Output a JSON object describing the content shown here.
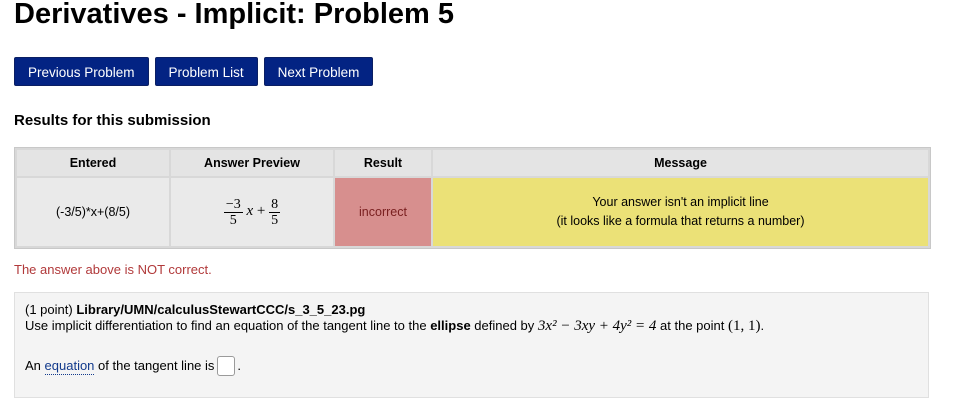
{
  "page_title": "Derivatives - Implicit: Problem 5",
  "nav": {
    "previous_label": "Previous Problem",
    "list_label": "Problem List",
    "next_label": "Next Problem"
  },
  "results": {
    "heading": "Results for this submission",
    "columns": [
      "Entered",
      "Answer Preview",
      "Result",
      "Message"
    ],
    "row": {
      "entered": "(-3/5)*x+(8/5)",
      "preview": {
        "num1": "−3",
        "den1": "5",
        "var": "x",
        "op": "+",
        "num2": "8",
        "den2": "5"
      },
      "result": "incorrect",
      "message_line1": "Your answer isn't an implicit line",
      "message_line2": "(it looks like a formula that returns a number)"
    },
    "not_correct_text": "The answer above is NOT correct."
  },
  "problem": {
    "points": "(1 point)",
    "path": "Library/UMN/calculusStewartCCC/s_3_5_23.pg",
    "text_before": "Use implicit differentiation to find an equation of the tangent line to the",
    "emphasis": "ellipse",
    "text_defined_by": "defined by",
    "equation": "3x² − 3xy + 4y² = 4",
    "text_at": "at the point",
    "point": "(1, 1)",
    "answer_prefix": "An",
    "answer_link": "equation",
    "answer_suffix": "of the tangent line is",
    "answer_value": ""
  },
  "colors": {
    "nav_button_bg": "#032383",
    "incorrect_bg": "#d78f8e",
    "message_bg": "#ebe177",
    "not_correct_text": "#b1393a"
  }
}
